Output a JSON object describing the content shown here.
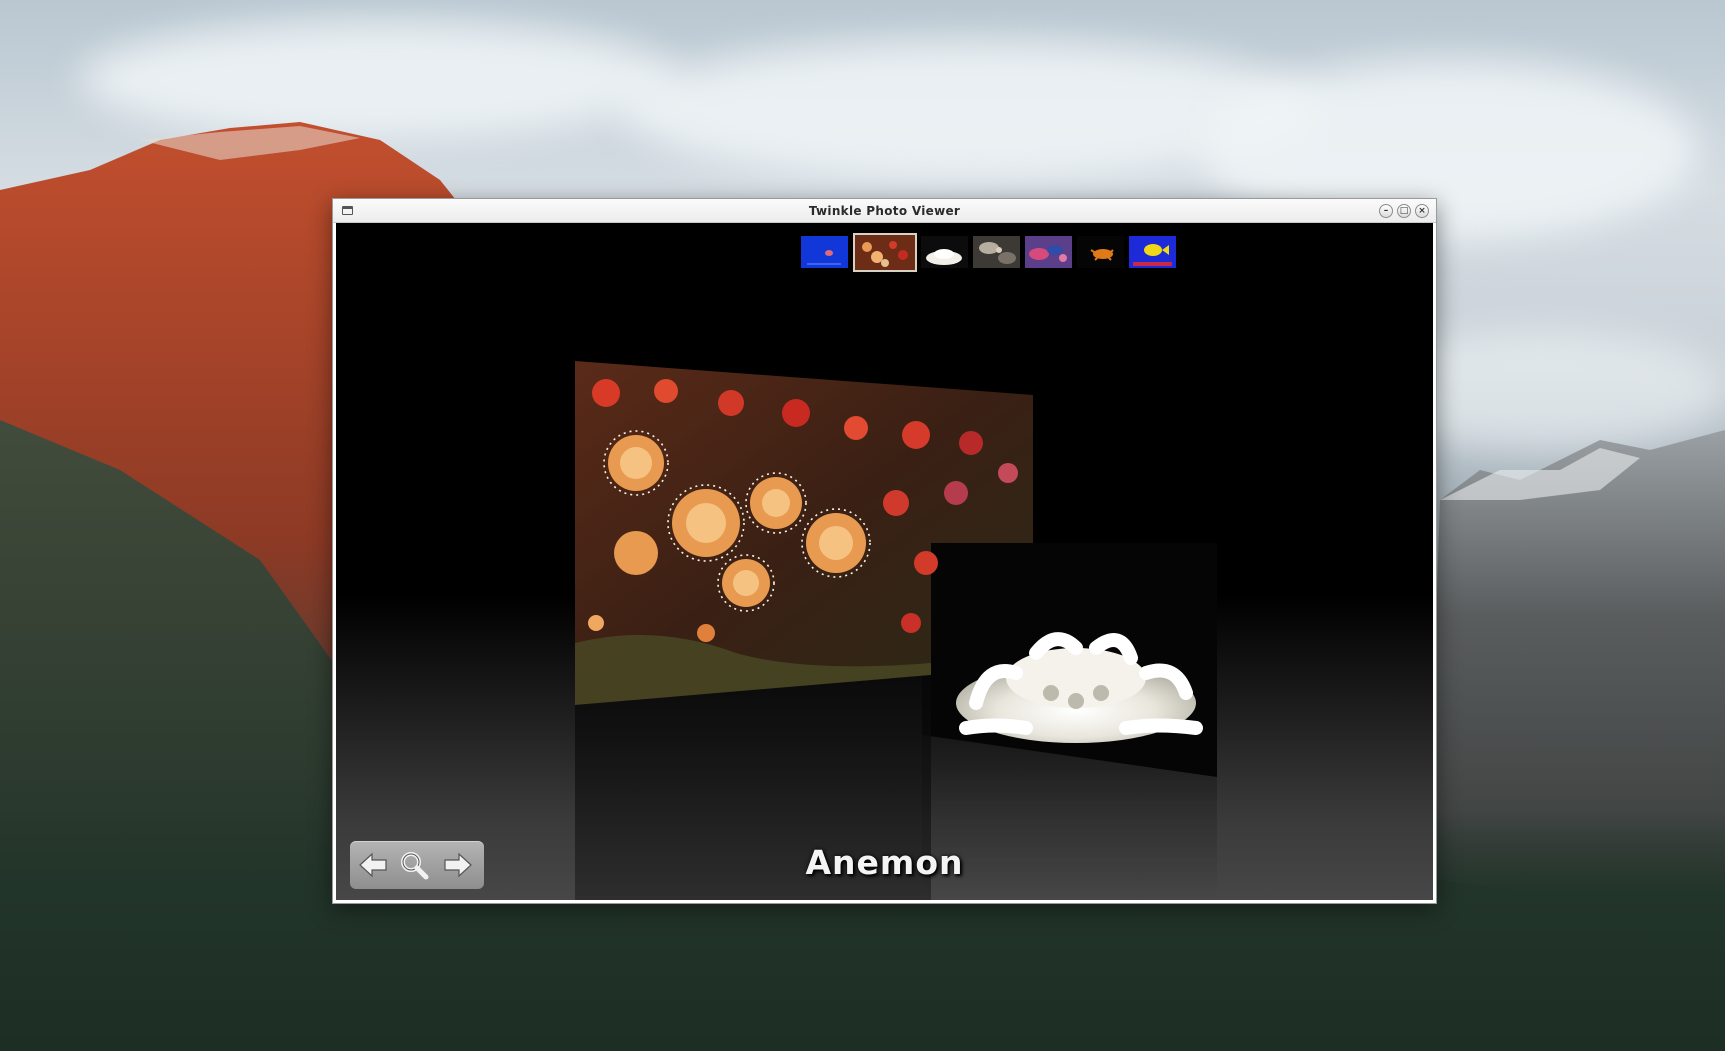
{
  "window": {
    "title": "Twinkle Photo Viewer",
    "minimize_glyph": "–",
    "maximize_glyph": "□",
    "close_glyph": "×"
  },
  "thumbnails": [
    {
      "name": "jellyfish-blue",
      "selected": false,
      "color_main": "#1237d8",
      "color_accent": "#e06a7a"
    },
    {
      "name": "anemon",
      "selected": true,
      "color_main": "#8a3a1c",
      "color_accent": "#e89a56"
    },
    {
      "name": "white-anemone",
      "selected": false,
      "color_main": "#0c0c0c",
      "color_accent": "#f2f0e8"
    },
    {
      "name": "fish-rocks",
      "selected": false,
      "color_main": "#3d3a35",
      "color_accent": "#b8aea0"
    },
    {
      "name": "coral-fish",
      "selected": false,
      "color_main": "#5b3f8a",
      "color_accent": "#d64a7c"
    },
    {
      "name": "orange-crab",
      "selected": false,
      "color_main": "#050505",
      "color_accent": "#e07a18"
    },
    {
      "name": "yellow-fish",
      "selected": false,
      "color_main": "#1c2ad8",
      "color_accent": "#f0d818"
    }
  ],
  "caption": "Anemon",
  "controls": {
    "prev_icon": "arrow-left-icon",
    "zoom_icon": "magnifier-icon",
    "next_icon": "arrow-right-icon"
  },
  "colors": {
    "viewer_background_top": "#000000",
    "viewer_background_bottom": "#474747",
    "control_panel": "#a0a0a0",
    "caption_text": "#f4f4f4"
  }
}
